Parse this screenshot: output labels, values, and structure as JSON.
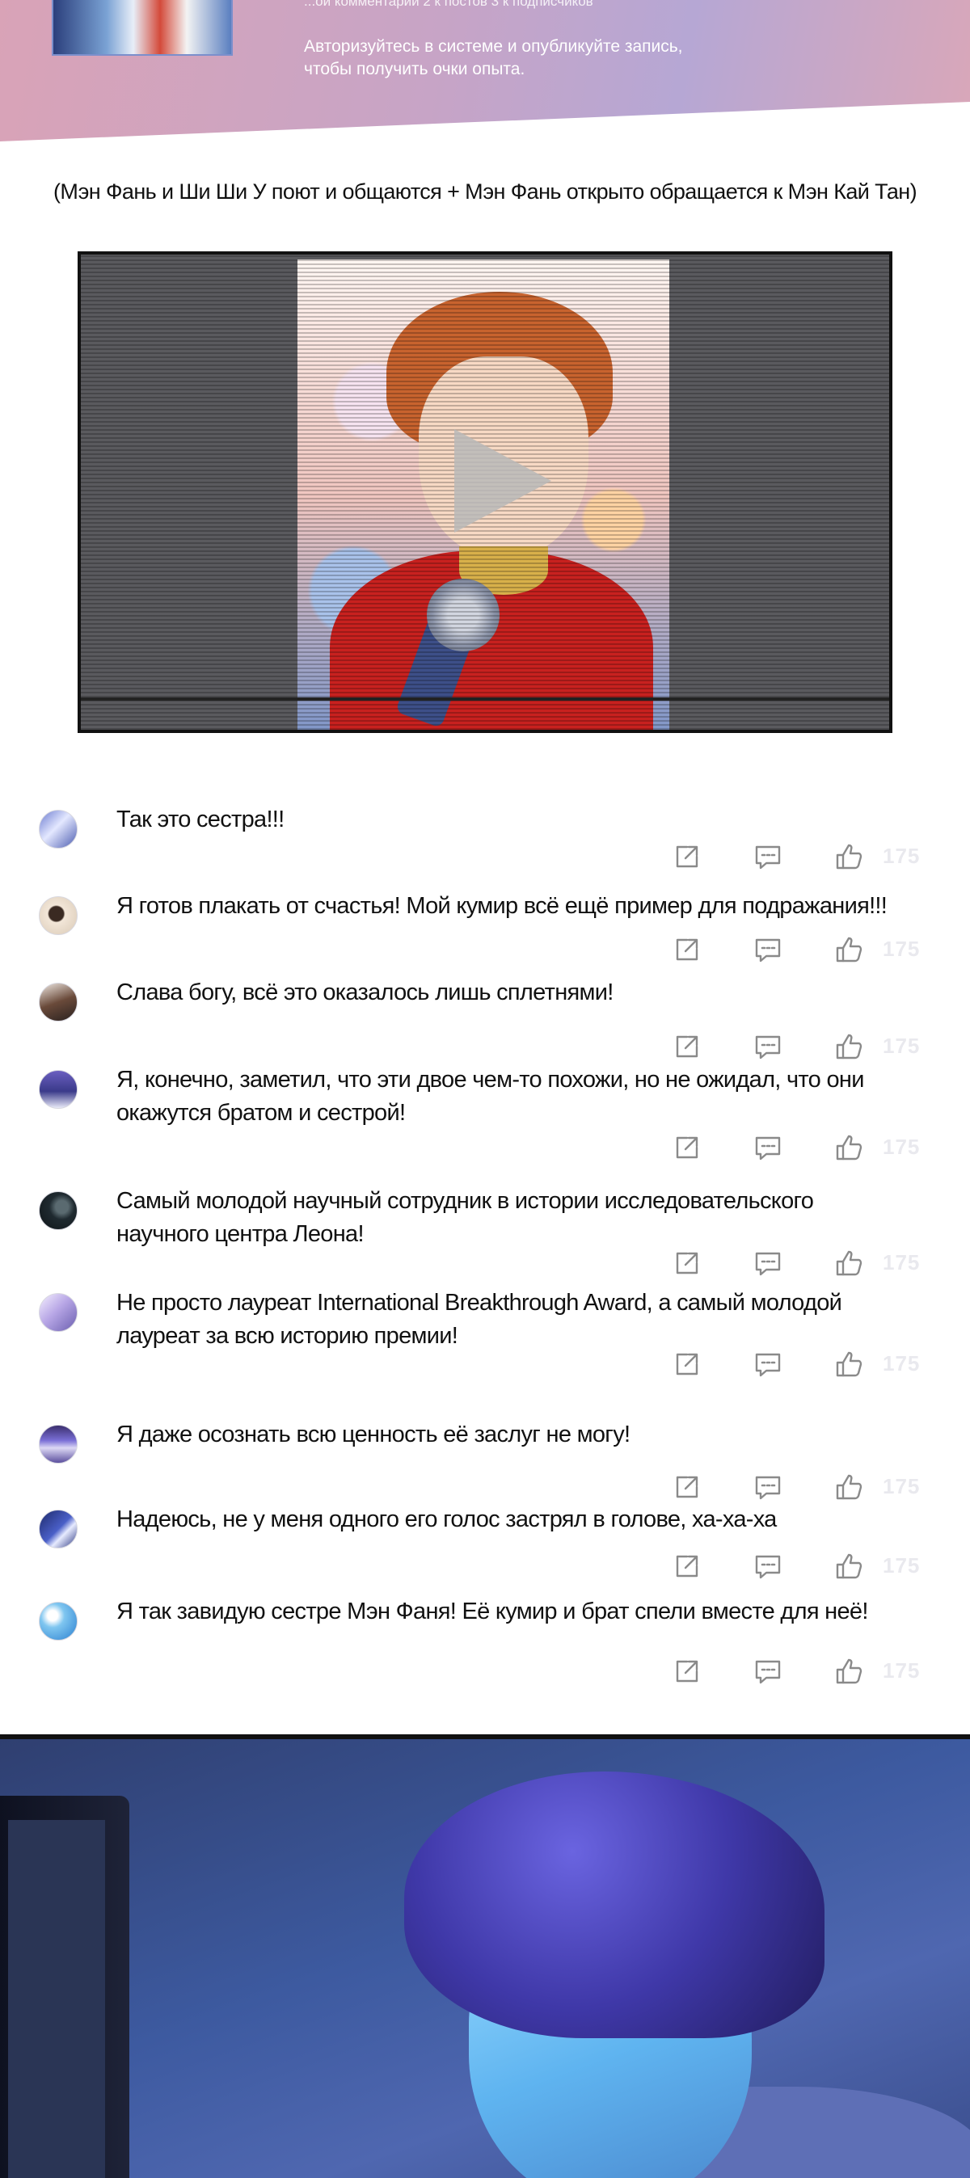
{
  "banner": {
    "small_text": "...ой комментарий 2 к постов 3 к подписчиков",
    "hint": "Авторизуйтесь в системе и опубликуйте запись, чтобы получить очки опыта."
  },
  "caption": "(Мэн Фань и Ши Ши У поют и общаются + Мэн Фань открыто обращается к Мэн Кай Тан)",
  "video": {
    "play_icon": "play-icon"
  },
  "icons": {
    "share": "share-icon",
    "reply": "comment-icon",
    "like": "thumbs-up-icon"
  },
  "colors": {
    "text": "#111111",
    "icon": "#8a8a8a",
    "like_count": "#e9e9ee",
    "banner_accent": "#c7a4c6"
  },
  "comments": [
    {
      "text": "Так это сестра!!!",
      "likes": "175"
    },
    {
      "text": "Я готов плакать от счастья! Мой кумир всё ещё пример для подражания!!!",
      "likes": "175"
    },
    {
      "text": "Слава богу, всё это оказалось лишь сплетнями!",
      "likes": "175"
    },
    {
      "text": "Я, конечно, заметил, что эти двое чем-то похожи, но не ожидал, что они окажутся братом и сестрой!",
      "likes": "175"
    },
    {
      "text": "Самый молодой научный сотрудник в истории исследовательского научного центра Леона!",
      "likes": "175"
    },
    {
      "text": "Не просто лауреат International Breakthrough Award, а самый молодой лауреат за всю историю премии!",
      "likes": "175"
    },
    {
      "text": "Я даже осознать всю ценность её заслуг не могу!",
      "likes": "175"
    },
    {
      "text": "Надеюсь, не у меня одного его голос застрял в голове, ха-ха-ха",
      "likes": "175"
    },
    {
      "text": "Я так завидую сестре Мэн Фаня! Её кумир и брат спели вместе для неё!",
      "likes": "175"
    }
  ]
}
